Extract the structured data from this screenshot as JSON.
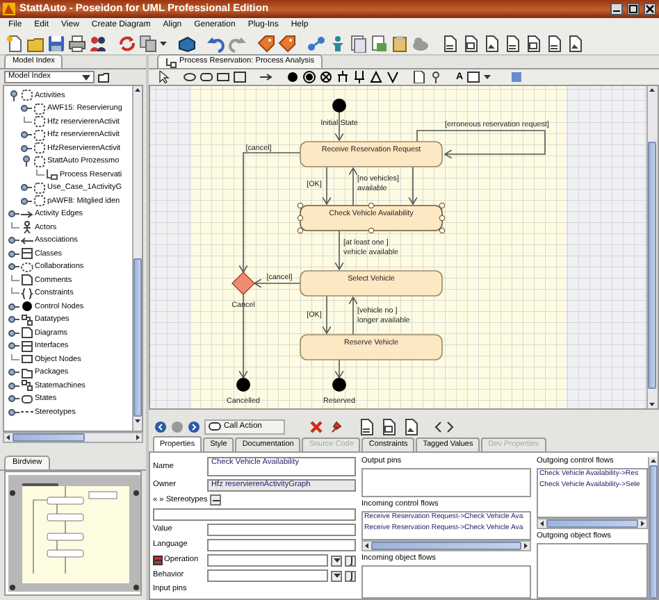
{
  "window": {
    "title": "StattAuto - Poseidon for UML Professional Edition"
  },
  "menu": [
    "File",
    "Edit",
    "View",
    "Create Diagram",
    "Align",
    "Generation",
    "Plug-Ins",
    "Help"
  ],
  "model_index": {
    "tab": "Model Index",
    "view_selector": "Model Index",
    "tree": [
      {
        "label": "Activities",
        "kind": "activity",
        "expandable": true,
        "expanded": true,
        "children": [
          {
            "label": "AWF15: Reservierung",
            "kind": "activity",
            "expandable": true,
            "expanded": false
          },
          {
            "label": "Hfz reservierenActivit",
            "kind": "activity",
            "expandable": false
          },
          {
            "label": "Hfz reservierenActivit",
            "kind": "activity",
            "expandable": true,
            "expanded": false
          },
          {
            "label": "HfzReservierenActivit",
            "kind": "activity",
            "expandable": true,
            "expanded": false
          },
          {
            "label": "StattAuto Prozessmo",
            "kind": "activity",
            "expandable": true,
            "expanded": true,
            "children": [
              {
                "label": "Process Reservati",
                "kind": "diagram-link",
                "expandable": false
              }
            ]
          },
          {
            "label": "Use_Case_1ActivityG",
            "kind": "activity",
            "expandable": true,
            "expanded": false
          },
          {
            "label": "pAWF8: Mitglied iden",
            "kind": "activity",
            "expandable": true,
            "expanded": false
          }
        ]
      },
      {
        "label": "Activity Edges",
        "kind": "edge",
        "expandable": true,
        "expanded": false
      },
      {
        "label": "Actors",
        "kind": "actor",
        "expandable": false
      },
      {
        "label": "Associations",
        "kind": "association",
        "expandable": true,
        "expanded": false
      },
      {
        "label": "Classes",
        "kind": "class",
        "expandable": true,
        "expanded": false
      },
      {
        "label": "Collaborations",
        "kind": "collaboration",
        "expandable": true,
        "expanded": false
      },
      {
        "label": "Comments",
        "kind": "comment",
        "expandable": false
      },
      {
        "label": "Constraints",
        "kind": "constraint",
        "expandable": false
      },
      {
        "label": "Control Nodes",
        "kind": "control-node",
        "expandable": true,
        "expanded": false
      },
      {
        "label": "Datatypes",
        "kind": "datatype",
        "expandable": true,
        "expanded": false
      },
      {
        "label": "Diagrams",
        "kind": "comment",
        "expandable": true,
        "expanded": false
      },
      {
        "label": "Interfaces",
        "kind": "class",
        "expandable": true,
        "expanded": false
      },
      {
        "label": "Object Nodes",
        "kind": "object-node",
        "expandable": false
      },
      {
        "label": "Packages",
        "kind": "package",
        "expandable": true,
        "expanded": false
      },
      {
        "label": "Statemachines",
        "kind": "datatype",
        "expandable": true,
        "expanded": false
      },
      {
        "label": "States",
        "kind": "state",
        "expandable": true,
        "expanded": false
      },
      {
        "label": "Stereotypes",
        "kind": "stereotype",
        "expandable": true,
        "expanded": false
      }
    ]
  },
  "birdview": {
    "tab": "Birdview"
  },
  "diagram": {
    "tab": "Process Reservation: Process Analysis",
    "font_tool": "A",
    "nodes": [
      {
        "kind": "initial",
        "label": "Initial State"
      },
      {
        "kind": "action",
        "label": "Receive Reservation Request",
        "selected": false
      },
      {
        "kind": "action",
        "label": "Check Vehicle Availability",
        "selected": true
      },
      {
        "kind": "action",
        "label": "Select Vehicle",
        "selected": false
      },
      {
        "kind": "action",
        "label": "Reserve Vehicle",
        "selected": false
      },
      {
        "kind": "decision",
        "label": "Cancel"
      },
      {
        "kind": "final",
        "label": "Cancelled"
      },
      {
        "kind": "final",
        "label": "Reserved"
      }
    ],
    "guards": [
      [
        "[cancel]"
      ],
      [
        "[erroneous reservation request]"
      ],
      [
        "[OK]"
      ],
      [
        "[no vehicles]",
        "available"
      ],
      [
        "[at least one ]",
        "vehicle available"
      ],
      [
        "[cancel]"
      ],
      [
        "[OK]"
      ],
      [
        "[vehicle no ]",
        "longer available"
      ]
    ]
  },
  "properties": {
    "element_type": "Call Action",
    "tabs": [
      {
        "label": "Properties",
        "selected": true,
        "disabled": false
      },
      {
        "label": "Style",
        "selected": false,
        "disabled": false
      },
      {
        "label": "Documentation",
        "selected": false,
        "disabled": false
      },
      {
        "label": "Source Code",
        "selected": false,
        "disabled": true
      },
      {
        "label": "Constraints",
        "selected": false,
        "disabled": false
      },
      {
        "label": "Tagged Values",
        "selected": false,
        "disabled": false
      },
      {
        "label": "Dev Properties",
        "selected": false,
        "disabled": true
      }
    ],
    "form": [
      {
        "kind": "textarea",
        "label": "Name",
        "value": "Check Vehicle Availability"
      },
      {
        "kind": "readonly",
        "label": "Owner",
        "value": "Hfz reservierenActivityGraph"
      },
      {
        "kind": "stereotypes",
        "label": "« » Stereotypes"
      },
      {
        "kind": "text",
        "label": "Value"
      },
      {
        "kind": "text",
        "label": "Language"
      },
      {
        "kind": "combo",
        "label": "Operation",
        "icon": true
      },
      {
        "kind": "combo",
        "label": "Behavior",
        "icon": false
      },
      {
        "kind": "heading",
        "label": "Input pins"
      }
    ],
    "middle": [
      {
        "label": "Output pins"
      },
      {
        "label": "Incoming control flows",
        "items": [
          "Receive Reservation Request->Check Vehicle Ava",
          "Receive Reservation Request->Check Vehicle Ava"
        ]
      },
      {
        "label": "Incoming object flows"
      }
    ],
    "right": [
      {
        "label": "Outgoing control flows",
        "items": [
          "Check Vehicle Availability->Res",
          "Check Vehicle Availability->Sele"
        ]
      },
      {
        "label": "Outgoing object flows"
      }
    ]
  }
}
